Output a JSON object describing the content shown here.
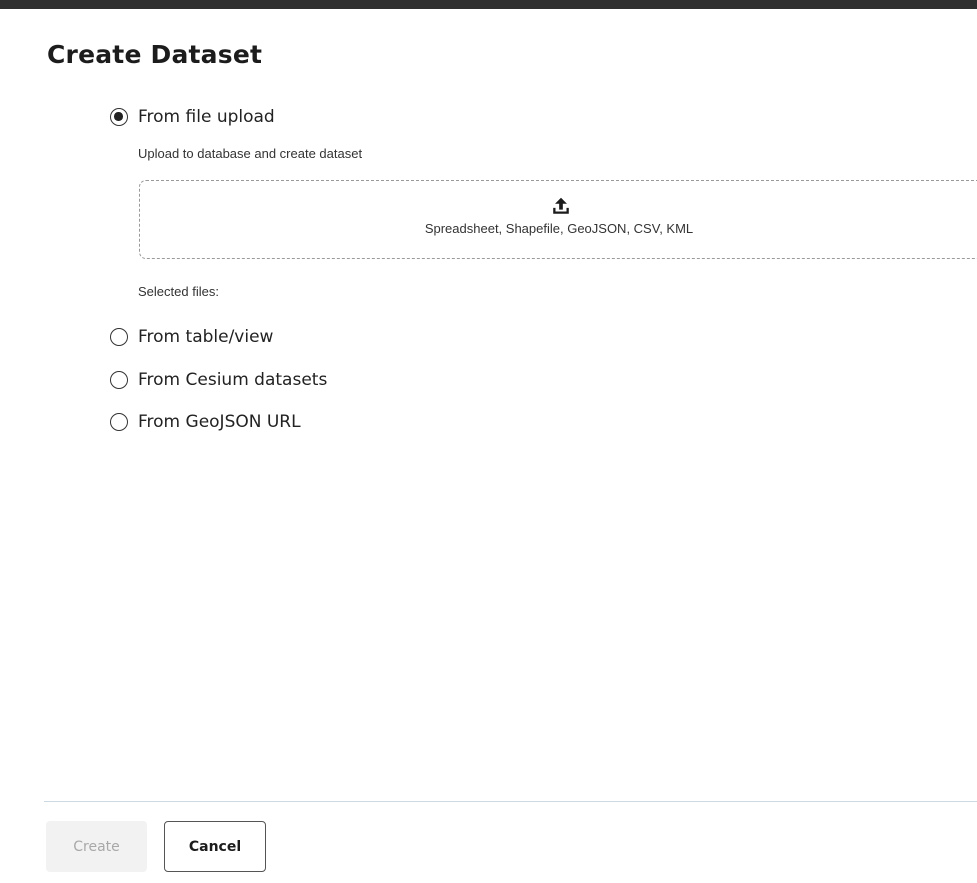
{
  "dialog": {
    "title": "Create Dataset"
  },
  "options": {
    "file_upload": {
      "label": "From file upload",
      "selected": true,
      "description": "Upload to database and create dataset",
      "dropzone_text": "Spreadsheet, Shapefile, GeoJSON, CSV, KML",
      "dropzone_icon": "upload-icon",
      "selected_files_label": "Selected files:"
    },
    "table_view": {
      "label": "From table/view",
      "selected": false
    },
    "cesium": {
      "label": "From Cesium datasets",
      "selected": false
    },
    "geojson_url": {
      "label": "From GeoJSON URL",
      "selected": false
    }
  },
  "footer": {
    "create_label": "Create",
    "create_disabled": true,
    "cancel_label": "Cancel"
  },
  "colors": {
    "top_bar": "#2f2f2f",
    "divider": "#cdd9e2",
    "disabled_button_bg": "#f2f2f2",
    "disabled_button_text": "#a8a8a8"
  }
}
